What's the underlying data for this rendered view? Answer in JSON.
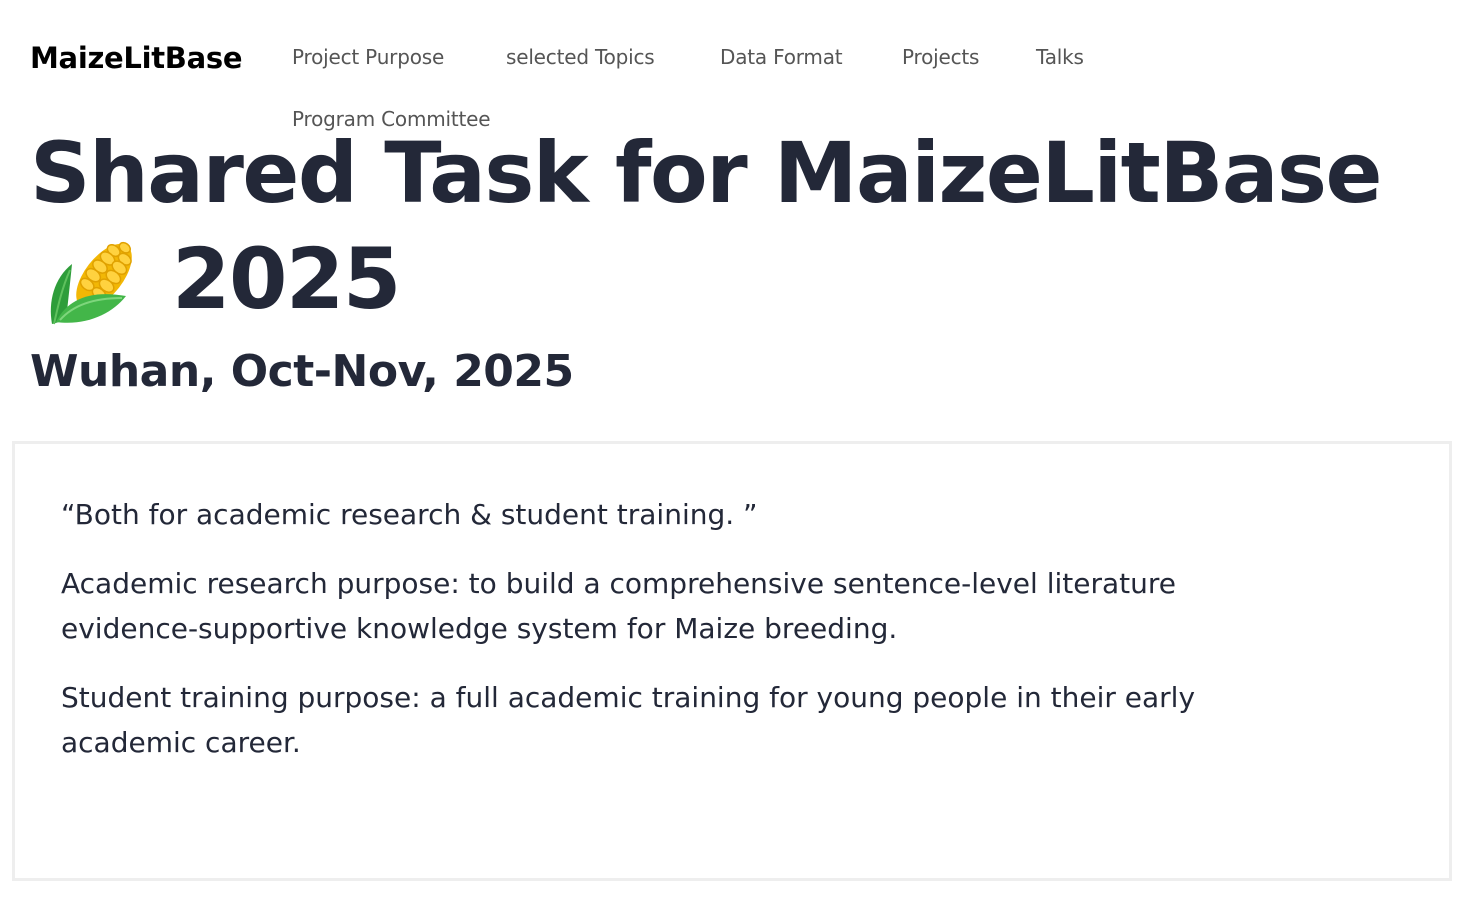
{
  "header": {
    "brand": "MaizeLitBase",
    "nav": [
      {
        "label": "Project Purpose"
      },
      {
        "label": "selected Topics"
      },
      {
        "label": "Data Format"
      },
      {
        "label": "Projects"
      },
      {
        "label": "Talks"
      },
      {
        "label": "Program Committee"
      }
    ]
  },
  "hero": {
    "title_line1": "Shared Task for MaizeLitBase",
    "year": "2025",
    "icon": "corn-emoji-icon",
    "subtitle": "Wuhan, Oct-Nov, 2025"
  },
  "purpose": {
    "quote": "“Both for academic research & student training. ”",
    "research": "Academic research purpose: to build a comprehensive sentence-level literature evidence-supportive knowledge system for Maize breeding.",
    "training": "Student training purpose: a full academic training for young people in their early academic career."
  },
  "colors": {
    "heading": "#232838",
    "nav_text": "#555555",
    "brand": "#000000",
    "card_border": "#eeeeee"
  }
}
